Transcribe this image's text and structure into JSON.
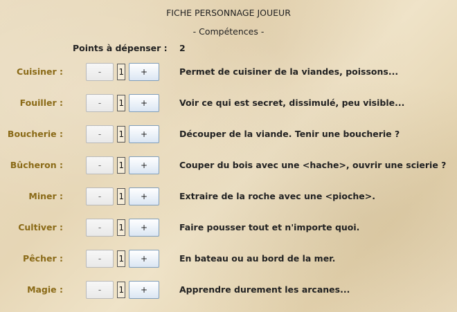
{
  "header": {
    "title": "FICHE PERSONNAGE JOUEUR",
    "subtitle": "- Compétences -"
  },
  "points": {
    "label": "Points à dépenser :",
    "value": "2"
  },
  "buttons": {
    "minus_label": "-",
    "plus_label": "+"
  },
  "skills": [
    {
      "name": "Cuisiner :",
      "value": "1",
      "description": "Permet de cuisiner de la viandes, poissons..."
    },
    {
      "name": "Fouiller :",
      "value": "1",
      "description": "Voir ce qui est secret, dissimulé, peu visible..."
    },
    {
      "name": "Boucherie :",
      "value": "1",
      "description": "Découper de la viande. Tenir une boucherie ?"
    },
    {
      "name": "Bûcheron :",
      "value": "1",
      "description": "Couper du bois avec une <hache>, ouvrir une scierie ?"
    },
    {
      "name": "Miner :",
      "value": "1",
      "description": "Extraire de la roche avec une <pioche>."
    },
    {
      "name": "Cultiver :",
      "value": "1",
      "description": "Faire pousser tout et n'importe quoi."
    },
    {
      "name": "Pêcher :",
      "value": "1",
      "description": "En bateau ou au bord de la mer."
    },
    {
      "name": "Magie :",
      "value": "1",
      "description": "Apprendre durement les arcanes..."
    }
  ],
  "colors": {
    "skill_name": "#8a6a17",
    "text": "#222222",
    "background": "#e8d9b9"
  }
}
